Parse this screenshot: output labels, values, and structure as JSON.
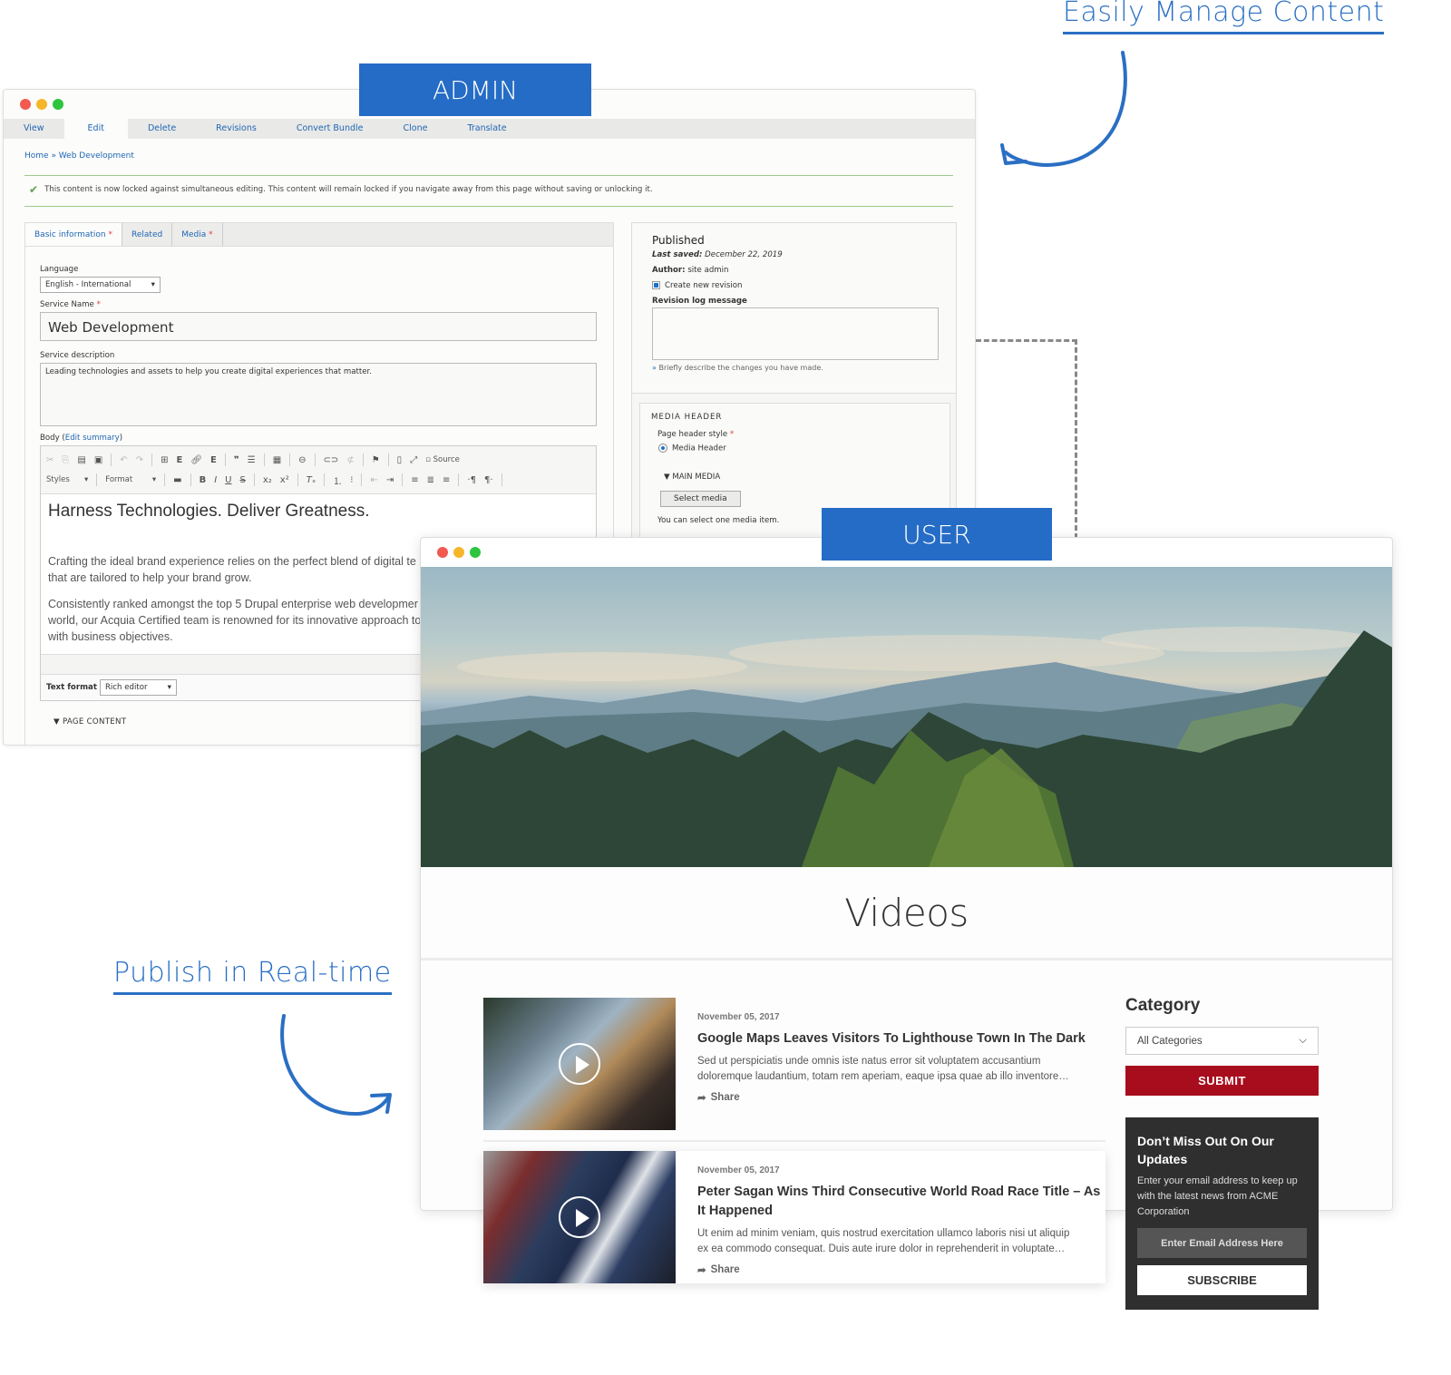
{
  "callouts": {
    "manage": "Easily Manage Content",
    "publish": "Publish in Real-time"
  },
  "badges": {
    "admin": "ADMIN",
    "user": "USER"
  },
  "colors": {
    "accent_blue": "#256cc6",
    "submit_red": "#a80d1e",
    "newsletter_bg": "#2f2f2f"
  },
  "admin": {
    "tabs": [
      {
        "label": "View"
      },
      {
        "label": "Edit",
        "active": true
      },
      {
        "label": "Delete"
      },
      {
        "label": "Revisions"
      },
      {
        "label": "Convert Bundle"
      },
      {
        "label": "Clone"
      },
      {
        "label": "Translate"
      }
    ],
    "breadcrumb": "Home » Web Development",
    "lock_message": "This content is now locked against simultaneous editing. This content will remain locked if you navigate away from this page without saving or unlocking it.",
    "form_tabs": [
      {
        "label": "Basic information",
        "required": "*"
      },
      {
        "label": "Related"
      },
      {
        "label": "Media",
        "required": "*"
      }
    ],
    "language_label": "Language",
    "language_value": "English - International",
    "service_name_label": "Service Name",
    "service_name_value": "Web Development",
    "service_desc_label": "Service description",
    "service_desc_value": "Leading technologies and assets to help you create digital experiences that matter.",
    "body_label": "Body (",
    "edit_summary": "Edit summary",
    "body_label_close": ")",
    "toolbar": {
      "source": "Source",
      "styles": "Styles",
      "format": "Format"
    },
    "editor": {
      "heading": "Harness Technologies. Deliver Greatness.",
      "p1_line1": "Crafting the ideal brand experience relies on the perfect blend of digital te",
      "p1_line2": "that are tailored to help your brand grow.",
      "p2_line1": "Consistently ranked amongst the top 5 Drupal enterprise web developmer",
      "p2_line2": "world, our Acquia Certified team is renowned for its innovative approach to",
      "p2_line3": "with business objectives."
    },
    "text_format_label": "Text format",
    "text_format_value": "Rich editor",
    "page_content": "▼ PAGE CONTENT",
    "sidebar": {
      "status": "Published",
      "last_saved_label": "Last saved:",
      "last_saved_value": "December 22, 2019",
      "author_label": "Author:",
      "author_value": "site admin",
      "create_revision": "Create new revision",
      "create_revision_checked": true,
      "revision_log_label": "Revision log message",
      "revision_hint": "Briefly describe the changes you have made.",
      "media_header_title": "MEDIA HEADER",
      "page_header_style_label": "Page header style",
      "page_header_style_value": "Media Header",
      "main_media": "▼ MAIN MEDIA",
      "select_media": "Select media",
      "select_media_hint": "You can select one media item."
    }
  },
  "user": {
    "page_title": "Videos",
    "videos": [
      {
        "date": "November 05, 2017",
        "title": "Google Maps Leaves Visitors To Lighthouse Town In The Dark",
        "desc_line1": "Sed ut perspiciatis unde omnis iste natus error sit voluptatem accusantium",
        "desc_line2": "doloremque laudantium, totam rem aperiam, eaque ipsa quae ab illo inventore…",
        "share": "Share"
      },
      {
        "date": "November 05, 2017",
        "title_line1": "Peter Sagan Wins Third Consecutive World Road Race Title – As",
        "title_line2": "It Happened",
        "desc_line1": "Ut enim ad minim veniam, quis nostrud exercitation ullamco laboris nisi ut aliquip",
        "desc_line2": "ex ea commodo consequat. Duis aute irure dolor in reprehenderit in voluptate…",
        "share": "Share"
      }
    ],
    "sidebar": {
      "category_title": "Category",
      "category_value": "All Categories",
      "submit": "SUBMIT",
      "newsletter_title_line1": "Don’t Miss Out On Our",
      "newsletter_title_line2": "Updates",
      "newsletter_text": "Enter your email address to keep up with the latest news from ACME Corporation",
      "email_placeholder": "Enter Email Address Here",
      "subscribe": "SUBSCRIBE"
    }
  }
}
